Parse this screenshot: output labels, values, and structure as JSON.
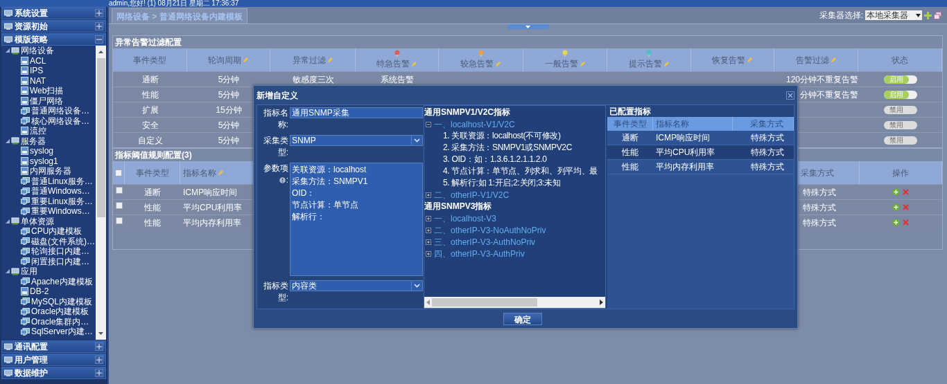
{
  "header": {
    "user_info": "admin,您好! (1) 08月21日 星期二 17:36:37"
  },
  "sidebar": {
    "sections": [
      {
        "label": "系统设置",
        "expanded": false
      },
      {
        "label": "资源初始",
        "expanded": false
      },
      {
        "label": "模版策略",
        "expanded": true,
        "tree": [
          {
            "label": "网络设备",
            "expanded": true,
            "children": [
              {
                "label": "ACL",
                "kind": "doc"
              },
              {
                "label": "IPS",
                "kind": "doc"
              },
              {
                "label": "NAT",
                "kind": "doc"
              },
              {
                "label": "Web扫描",
                "kind": "doc"
              },
              {
                "label": "僵尸网络",
                "kind": "doc"
              },
              {
                "label": "普通网络设备…",
                "kind": "monitor"
              },
              {
                "label": "核心网络设备…",
                "kind": "monitor"
              },
              {
                "label": "流控",
                "kind": "doc"
              }
            ]
          },
          {
            "label": "服务器",
            "expanded": true,
            "children": [
              {
                "label": "syslog",
                "kind": "doc"
              },
              {
                "label": "syslog1",
                "kind": "doc"
              },
              {
                "label": "内网服务器",
                "kind": "doc"
              },
              {
                "label": "普通Linux服务…",
                "kind": "monitor"
              },
              {
                "label": "普通Windows…",
                "kind": "monitor"
              },
              {
                "label": "重要Linux服务…",
                "kind": "monitor"
              },
              {
                "label": "重要Windows…",
                "kind": "monitor"
              }
            ]
          },
          {
            "label": "单体资源",
            "expanded": true,
            "children": [
              {
                "label": "CPU内建模板",
                "kind": "monitor"
              },
              {
                "label": "磁盘(文件系统)…",
                "kind": "monitor"
              },
              {
                "label": "轮询接口内建…",
                "kind": "monitor"
              },
              {
                "label": "闲置接口内建…",
                "kind": "monitor"
              }
            ]
          },
          {
            "label": "应用",
            "expanded": true,
            "children": [
              {
                "label": "Apache内建模板",
                "kind": "monitor"
              },
              {
                "label": "DB-2",
                "kind": "doc"
              },
              {
                "label": "MySQL内建模板",
                "kind": "monitor"
              },
              {
                "label": "Oracle内建模板",
                "kind": "monitor"
              },
              {
                "label": "Oracle集群内…",
                "kind": "monitor"
              },
              {
                "label": "SqlServer内建…",
                "kind": "monitor"
              }
            ]
          }
        ]
      },
      {
        "label": "通讯配置",
        "expanded": false
      },
      {
        "label": "用户管理",
        "expanded": false
      },
      {
        "label": "数据维护",
        "expanded": false
      }
    ]
  },
  "breadcrumb": {
    "path": "网络设备 > 普通网络设备内建模板"
  },
  "collector": {
    "label": "采集器选择:",
    "value": "本地采集器"
  },
  "alarm_filter": {
    "title": "异常告警过滤配置",
    "columns": [
      {
        "label": "事件类型",
        "editable": false
      },
      {
        "label": "轮询周期",
        "editable": true
      },
      {
        "label": "异常过滤",
        "editable": true
      },
      {
        "label": "特急告警",
        "editable": true,
        "color": "#e05a5a"
      },
      {
        "label": "较急告警",
        "editable": true,
        "color": "#e8a040"
      },
      {
        "label": "一般告警",
        "editable": true,
        "color": "#e8d450"
      },
      {
        "label": "提示告警",
        "editable": true,
        "color": "#48c0c8"
      },
      {
        "label": "恢复告警",
        "editable": true
      },
      {
        "label": "告警过滤",
        "editable": true
      },
      {
        "label": "状态",
        "editable": false
      }
    ],
    "rows": [
      {
        "event": "通断",
        "period": "5分钟",
        "anomaly": "敏感度三次",
        "critical": "系统告警",
        "alarm_filter": "120分钟不重复告警",
        "status": {
          "label": "启用",
          "on": true
        }
      },
      {
        "event": "性能",
        "period": "5分钟",
        "alarm_filter": "分钟不重复告警",
        "status": {
          "label": "启用",
          "on": true
        }
      },
      {
        "event": "扩展",
        "period": "15分钟",
        "status": {
          "label": "禁用",
          "on": false
        }
      },
      {
        "event": "安全",
        "period": "5分钟",
        "status": {
          "label": "禁用",
          "on": false
        }
      },
      {
        "event": "自定义",
        "period": "5分钟",
        "status": {
          "label": "禁用",
          "on": false
        }
      }
    ]
  },
  "thresholds": {
    "title": "指标阈值规则配置(3)",
    "all_checked": false,
    "columns": [
      {
        "label": "事件类型",
        "editable": false
      },
      {
        "label": "指标名称",
        "editable": true
      },
      {
        "label": "采集方式",
        "editable": false
      },
      {
        "label": "操作",
        "editable": false
      }
    ],
    "rows": [
      {
        "checked": false,
        "event": "通断",
        "name": "ICMP响应时间",
        "method": "特殊方式"
      },
      {
        "checked": false,
        "event": "性能",
        "name": "平均CPU利用率",
        "method": "特殊方式"
      },
      {
        "checked": false,
        "event": "性能",
        "name": "平均内存利用率",
        "method": "特殊方式"
      }
    ]
  },
  "dialog": {
    "title": "新增自定义",
    "fields": [
      {
        "kind": "text",
        "label": "指标名称:",
        "value": "通用SNMP采集"
      },
      {
        "kind": "select",
        "label": "采集类型:",
        "value": "SNMP"
      },
      {
        "kind": "textarea",
        "label": "参数项",
        "label_end": ":",
        "lines": [
          "关联资源：localhost",
          "采集方法：SNMPV1",
          "OID：",
          "节点计算：单节点",
          "解析行："
        ]
      },
      {
        "kind": "select",
        "label": "指标类型:",
        "value": "内容类"
      }
    ],
    "tree": [
      {
        "title": "通用SNMPV1/V2C指标",
        "nodes": [
          {
            "label": "一、localhost-V1/V2C",
            "expanded": true,
            "children": [
              "1. 关联资源：localhost(不可修改)",
              "2. 采集方法：SNMPV1或SNMPV2C",
              "3. OID：如：1.3.6.1.2.1.1.2.0",
              "4. 节点计算：单节点、列求和、列平均、最",
              "5. 解析行:如 1:开启;2:关闭;3:未知"
            ]
          },
          {
            "label": "二、otherIP-V1/V2C",
            "expanded": false
          }
        ]
      },
      {
        "title": "通用SNMPV3指标",
        "nodes": [
          {
            "label": "一、localhost-V3",
            "expanded": false
          },
          {
            "label": "二、otherIP-V3-NoAuthNoPriv",
            "expanded": false
          },
          {
            "label": "三、otherIP-V3-AuthNoPriv",
            "expanded": false
          },
          {
            "label": "四、otherIP-V3-AuthPriv",
            "expanded": false
          }
        ]
      }
    ],
    "configured": {
      "title": "已配置指标",
      "columns": [
        "事件类型",
        "指标名称",
        "采集方式"
      ],
      "rows": [
        {
          "event": "通断",
          "name": "ICMP响应时间",
          "method": "特殊方式",
          "selected": false
        },
        {
          "event": "性能",
          "name": "平均CPU利用率",
          "method": "特殊方式",
          "selected": true
        },
        {
          "event": "性能",
          "name": "平均内存利用率",
          "method": "特殊方式",
          "selected": false
        }
      ]
    },
    "button": "确定"
  }
}
